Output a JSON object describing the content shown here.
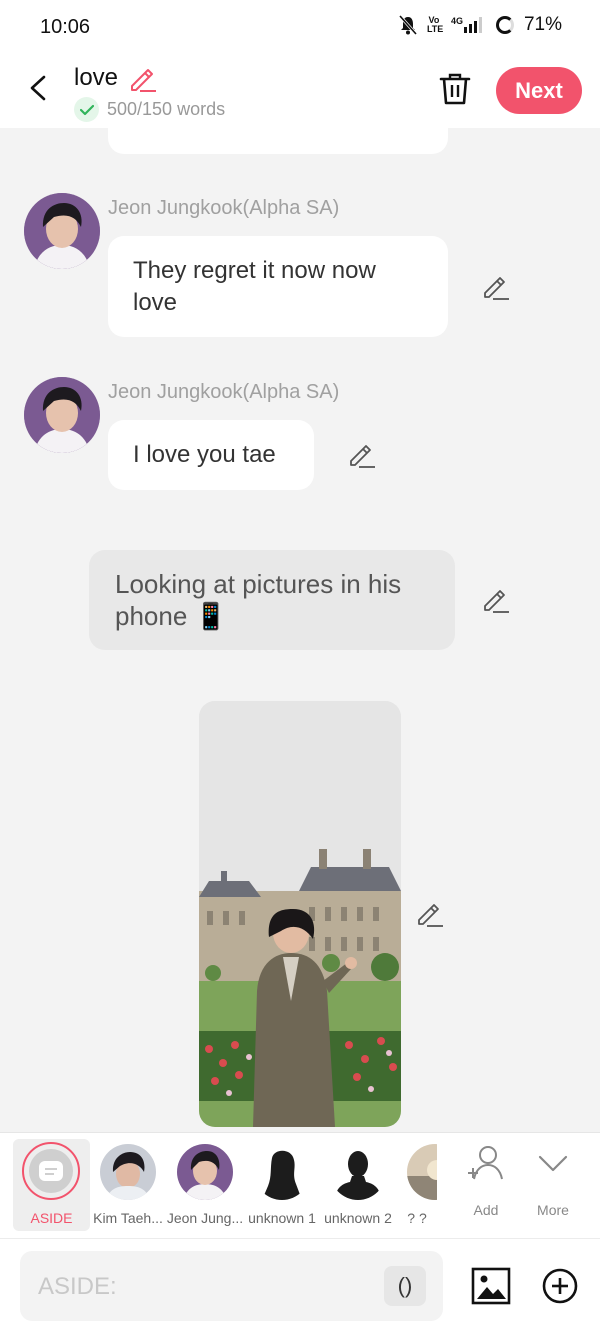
{
  "status": {
    "time": "10:06",
    "network": "4G",
    "volte": "Vo LTE",
    "battery": "71%"
  },
  "header": {
    "title": "love",
    "words": "500/150 words",
    "next_label": "Next"
  },
  "messages": [
    {
      "kind": "bubble",
      "speaker": "Jeon Jungkook(Alpha SA)",
      "text_lines": [
        "They regret it now now",
        "love"
      ]
    },
    {
      "kind": "bubble",
      "speaker": "Jeon Jungkook(Alpha SA)",
      "text": "I love you tae"
    },
    {
      "kind": "aside",
      "text_lines": [
        "Looking at pictures in his",
        "phone 📱"
      ]
    },
    {
      "kind": "image"
    }
  ],
  "characters": [
    {
      "label": "ASIDE"
    },
    {
      "label": "Kim Taeh..."
    },
    {
      "label": "Jeon Jung..."
    },
    {
      "label": "unknown 1"
    },
    {
      "label": "unknown 2"
    },
    {
      "label": "? ?"
    }
  ],
  "tools": {
    "add_label": "Add",
    "more_label": "More"
  },
  "input": {
    "placeholder": "ASIDE:",
    "paren_label": "()"
  },
  "colors": {
    "accent": "#f2536c",
    "background": "#f3f3f3"
  }
}
